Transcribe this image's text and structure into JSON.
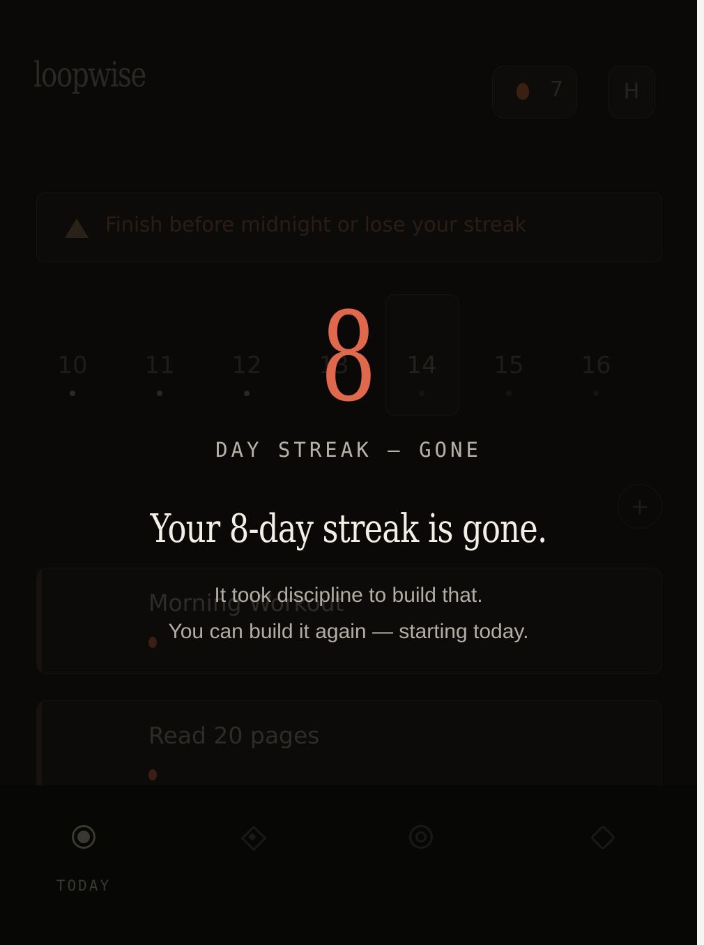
{
  "app": {
    "brand": "loopwise",
    "brand_subtitle": "",
    "streak_count": "7",
    "avatar_initial": "H"
  },
  "warning": {
    "text": "Finish before midnight or lose your streak"
  },
  "week": {
    "days": [
      {
        "dow": "",
        "date": "10"
      },
      {
        "dow": "",
        "date": "11"
      },
      {
        "dow": "",
        "date": "12"
      },
      {
        "dow": "",
        "date": "13"
      },
      {
        "dow": "",
        "date": "14"
      },
      {
        "dow": "",
        "date": "15"
      },
      {
        "dow": "",
        "date": "16"
      }
    ],
    "today_index": 4
  },
  "habits": {
    "section_label": "",
    "add_label": "+",
    "items": [
      {
        "title": "Morning Workout",
        "meta": ""
      },
      {
        "title": "Read 20 pages",
        "meta": ""
      }
    ]
  },
  "nav": {
    "items": [
      {
        "label": "TODAY",
        "icon": "target-icon",
        "active": true
      },
      {
        "label": "",
        "icon": "diamond-icon",
        "active": false
      },
      {
        "label": "",
        "icon": "circle-icon",
        "active": false
      },
      {
        "label": "",
        "icon": "tag-icon",
        "active": false
      }
    ]
  },
  "overlay": {
    "streak_number": "8",
    "kicker": "DAY STREAK — GONE",
    "headline": "Your 8-day streak is gone.",
    "body_line_1": "It took discipline to build that.",
    "body_line_2": "You can build it again — starting today."
  },
  "colors": {
    "accent": "#e0694d",
    "background": "#0a0908",
    "headline": "#f4efe6",
    "muted": "#b3aea5"
  }
}
